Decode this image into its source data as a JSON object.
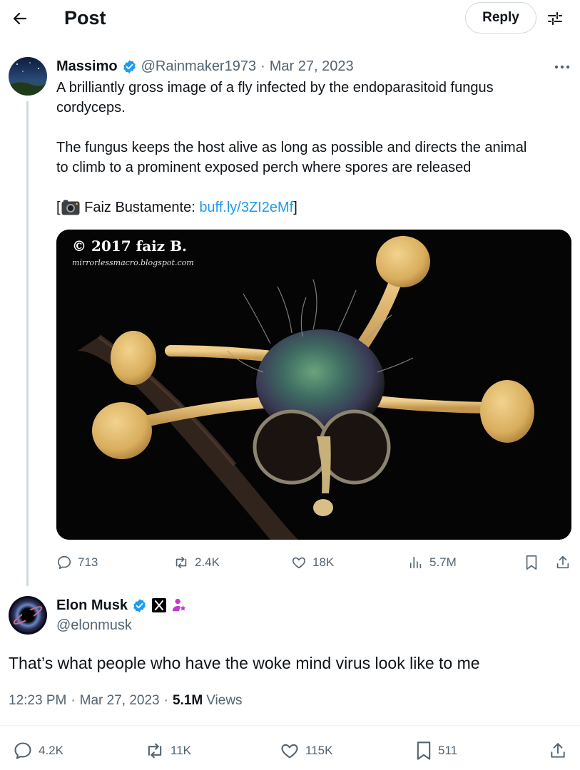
{
  "header": {
    "title": "Post",
    "reply_label": "Reply"
  },
  "quoted_post": {
    "display_name": "Massimo",
    "handle": "@Rainmaker1973",
    "separator": "·",
    "date": "Mar 27, 2023",
    "text_line1": "A brilliantly gross image of a fly infected by the endoparasitoid fungus",
    "text_line2": "cordyceps.",
    "text_line3": "The fungus keeps the host alive as long as possible and directs the animal",
    "text_line4": "to climb to a prominent exposed perch where spores are released",
    "credit_open": "[",
    "credit_name": " Faiz Bustamente: ",
    "credit_link": "buff.ly/3ZI2eMf",
    "credit_close": "]",
    "image_watermark_line1": "© 2017 faiz B.",
    "image_watermark_line2": "mirrorlessmacro.blogspot.com",
    "stats": {
      "replies": "713",
      "reposts": "2.4K",
      "likes": "18K",
      "views": "5.7M"
    }
  },
  "main_post": {
    "display_name": "Elon Musk",
    "handle": "@elonmusk",
    "text": "That’s what people who have the woke mind virus look like to me",
    "time": "12:23 PM",
    "date": "Mar 27, 2023",
    "separator": "·",
    "views_count": "5.1M",
    "views_label": "Views",
    "stats": {
      "replies": "4.2K",
      "reposts": "11K",
      "likes": "115K",
      "bookmarks": "511"
    }
  },
  "colors": {
    "link": "#1d9bf0",
    "verified": "#1d9bf0",
    "muted": "#536471",
    "affiliate": "#c43bd2"
  },
  "icons": [
    "back-arrow-icon",
    "settings-sliders-icon",
    "verified-badge-icon",
    "more-icon",
    "camera-icon",
    "reply-icon",
    "repost-icon",
    "like-icon",
    "views-icon",
    "bookmark-icon",
    "share-icon",
    "x-affiliate-icon",
    "person-star-icon"
  ]
}
